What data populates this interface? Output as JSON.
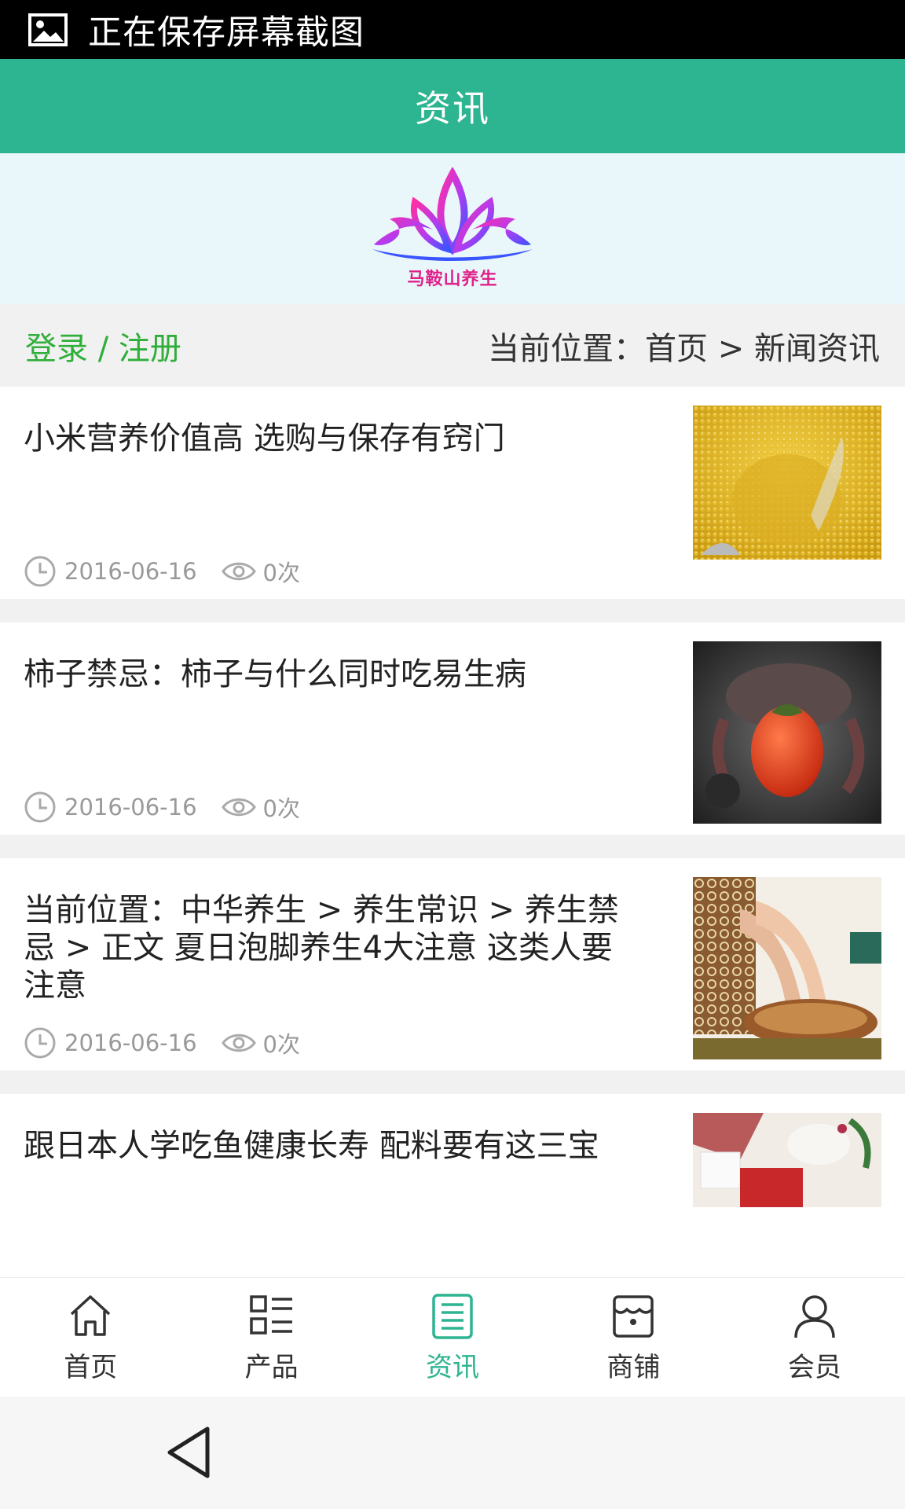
{
  "status_bar": {
    "text": "正在保存屏幕截图"
  },
  "header": {
    "title": "资讯"
  },
  "banner": {
    "brand_text": "马鞍山养生"
  },
  "location": {
    "login_label": "登录",
    "separator": " / ",
    "register_label": "注册",
    "crumbs_text": "当前位置：首页 > 新闻资讯"
  },
  "articles": [
    {
      "title": "小米营养价值高 选购与保存有窍门",
      "date": "2016-06-16",
      "views": "0次",
      "image": "millet-photo"
    },
    {
      "title": "柿子禁忌：柿子与什么同时吃易生病",
      "date": "2016-06-16",
      "views": "0次",
      "image": "crab-persimmon-photo"
    },
    {
      "title": "当前位置：中华养生 > 养生常识 > 养生禁忌 > 正文 夏日泡脚养生4大注意 这类人要注意",
      "date": "2016-06-16",
      "views": "0次",
      "image": "foot-soak-photo"
    },
    {
      "title": "跟日本人学吃鱼健康长寿 配料要有这三宝",
      "image": "sashimi-photo"
    }
  ],
  "tabs": [
    {
      "label": "首页",
      "icon": "home-icon"
    },
    {
      "label": "产品",
      "icon": "grid-list-icon"
    },
    {
      "label": "资讯",
      "icon": "news-icon",
      "active": true
    },
    {
      "label": "商铺",
      "icon": "shop-icon"
    },
    {
      "label": "会员",
      "icon": "user-icon"
    }
  ],
  "colors": {
    "accent": "#2db490",
    "login_green": "#2fae3a",
    "page_gray": "#f1f1f1"
  }
}
